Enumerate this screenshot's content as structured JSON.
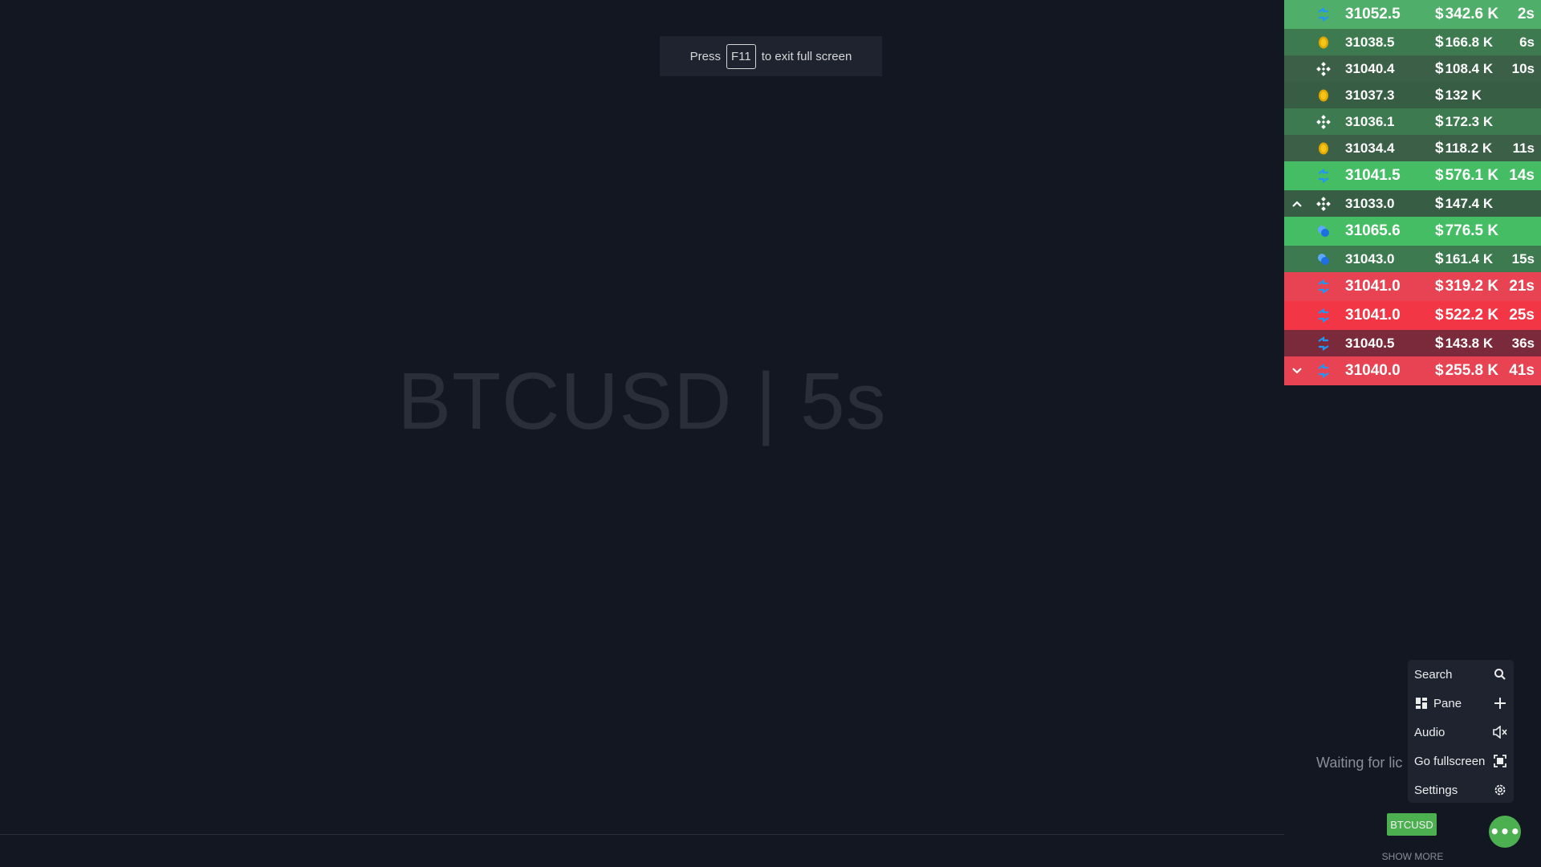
{
  "watermark": "BTCUSD | 5s",
  "fullscreen_toast": {
    "prefix": "Press",
    "key": "F11",
    "suffix": "to exit full screen"
  },
  "trades": [
    {
      "price": "31052.5",
      "amount": "342.6 K",
      "age": "2s",
      "exchange_icon": "bitmex-icon",
      "arrow": "",
      "side": "buy"
    },
    {
      "price": "31038.5",
      "amount": "166.8 K",
      "age": "6s",
      "exchange_icon": "coinbase-icon",
      "arrow": "",
      "side": "buy"
    },
    {
      "price": "31040.4",
      "amount": "108.4 K",
      "age": "10s",
      "exchange_icon": "binance-icon",
      "arrow": "",
      "side": "buy"
    },
    {
      "price": "31037.3",
      "amount": "132 K",
      "age": "",
      "exchange_icon": "coinbase-icon",
      "arrow": "",
      "side": "buy"
    },
    {
      "price": "31036.1",
      "amount": "172.3 K",
      "age": "",
      "exchange_icon": "binance-icon",
      "arrow": "",
      "side": "buy"
    },
    {
      "price": "31034.4",
      "amount": "118.2 K",
      "age": "11s",
      "exchange_icon": "coinbase-icon",
      "arrow": "",
      "side": "buy"
    },
    {
      "price": "31041.5",
      "amount": "576.1 K",
      "age": "14s",
      "exchange_icon": "bitmex-icon",
      "arrow": "",
      "side": "buy"
    },
    {
      "price": "31033.0",
      "amount": "147.4 K",
      "age": "",
      "exchange_icon": "binance-icon",
      "arrow": "up",
      "side": "buy"
    },
    {
      "price": "31065.6",
      "amount": "776.5 K",
      "age": "",
      "exchange_icon": "ftx-icon",
      "arrow": "",
      "side": "buy"
    },
    {
      "price": "31043.0",
      "amount": "161.4 K",
      "age": "15s",
      "exchange_icon": "ftx-icon",
      "arrow": "",
      "side": "buy"
    },
    {
      "price": "31041.0",
      "amount": "319.2 K",
      "age": "21s",
      "exchange_icon": "bitmex-icon",
      "arrow": "",
      "side": "sell"
    },
    {
      "price": "31041.0",
      "amount": "522.2 K",
      "age": "25s",
      "exchange_icon": "bitmex-icon",
      "arrow": "",
      "side": "sell"
    },
    {
      "price": "31040.5",
      "amount": "143.8 K",
      "age": "36s",
      "exchange_icon": "bitmex-icon",
      "arrow": "",
      "side": "sell"
    },
    {
      "price": "31040.0",
      "amount": "255.8 K",
      "age": "41s",
      "exchange_icon": "bitmex-icon",
      "arrow": "down",
      "side": "sell"
    }
  ],
  "currency_symbol": "$",
  "waiting_text": "Waiting for lic",
  "menu": {
    "items": [
      {
        "label": "Search",
        "icon": "search-icon"
      },
      {
        "label": "Pane",
        "icon": "plus-icon",
        "prefix_icon": "pane-icon"
      },
      {
        "label": "Audio",
        "icon": "speaker-muted-icon"
      },
      {
        "label": "Go fullscreen",
        "icon": "fullscreen-icon"
      },
      {
        "label": "Settings",
        "icon": "gear-icon"
      }
    ]
  },
  "symbol_chip": "BTCUSD",
  "fab_label": "•••",
  "show_more": "SHOW MORE",
  "colors": {
    "background": "#131722",
    "buy": "#4caf50",
    "sell": "#f23645",
    "menu_bg": "#1f2330"
  }
}
